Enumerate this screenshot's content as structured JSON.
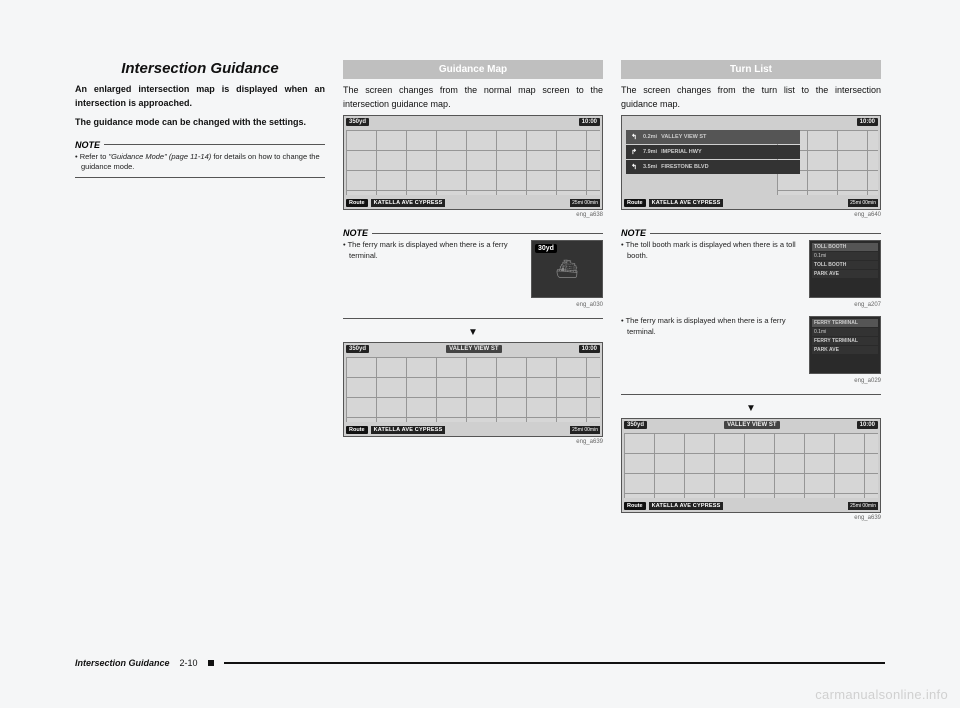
{
  "page": {
    "title": "Intersection Guidance",
    "intro1": "An enlarged intersection map is displayed when an intersection is approached.",
    "intro2": "The guidance mode can be changed with the settings.",
    "note_head": "NOTE",
    "note1_prefix": "• Refer to ",
    "note1_ref": "\"Guidance Mode\" (page 11-14)",
    "note1_suffix": " for details on how to change the guidance mode."
  },
  "col2": {
    "tab": "Guidance Map",
    "body": "The screen changes from the normal map screen to the intersection guidance map.",
    "shot1": {
      "dist": "350yd",
      "time": "10:00",
      "route": "Route",
      "addr": "KATELLA AVE  CYPRESS",
      "meter": "25mi 00min",
      "cap": "eng_a638"
    },
    "note_head": "NOTE",
    "note_ferry": "• The ferry mark is displayed when there is a ferry terminal.",
    "ferry_thumb": {
      "dist": "30yd",
      "cap": "eng_a030"
    },
    "arrow": "▼",
    "shot2": {
      "dist": "350yd",
      "banner": "VALLEY VIEW ST",
      "time": "10:00",
      "route": "Route",
      "addr": "KATELLA AVE  CYPRESS",
      "meter": "25mi 00min",
      "cap": "eng_a639"
    }
  },
  "col3": {
    "tab": "Turn List",
    "body": "The screen changes from the turn list to the intersection guidance map.",
    "shot1": {
      "dist": "0.2mi",
      "time": "10:00",
      "rows": [
        {
          "d": "0.2mi",
          "t": "VALLEY VIEW ST",
          "hl": true,
          "arr": "↰"
        },
        {
          "d": "7.9mi",
          "t": "IMPERIAL HWY",
          "arr": "↱"
        },
        {
          "d": "3.5mi",
          "t": "FIRESTONE BLVD",
          "arr": "↰"
        }
      ],
      "route": "Route",
      "addr": "KATELLA AVE  CYPRESS",
      "meter": "25mi 00min",
      "cap": "eng_a640"
    },
    "note_head": "NOTE",
    "note_toll": "• The toll booth mark is displayed when there is a toll booth.",
    "toll_thumb": {
      "rows": [
        "TOLL BOOTH",
        "0.1mi",
        "TOLL BOOTH",
        "PARK AVE"
      ],
      "cap": "eng_a207"
    },
    "note_ferry": "• The ferry mark is displayed when there is a ferry terminal.",
    "ferry_thumb": {
      "rows": [
        "FERRY TERMINAL",
        "0.1mi",
        "FERRY TERMINAL",
        "PARK AVE"
      ],
      "cap": "eng_a029"
    },
    "arrow": "▼",
    "shot2": {
      "dist": "350yd",
      "banner": "VALLEY VIEW ST",
      "time": "10:00",
      "route": "Route",
      "addr": "KATELLA AVE  CYPRESS",
      "meter": "25mi 00min",
      "cap": "eng_a639"
    }
  },
  "footer": {
    "title": "Intersection Guidance",
    "num": "2-10"
  },
  "watermark": "carmanualsonline.info"
}
